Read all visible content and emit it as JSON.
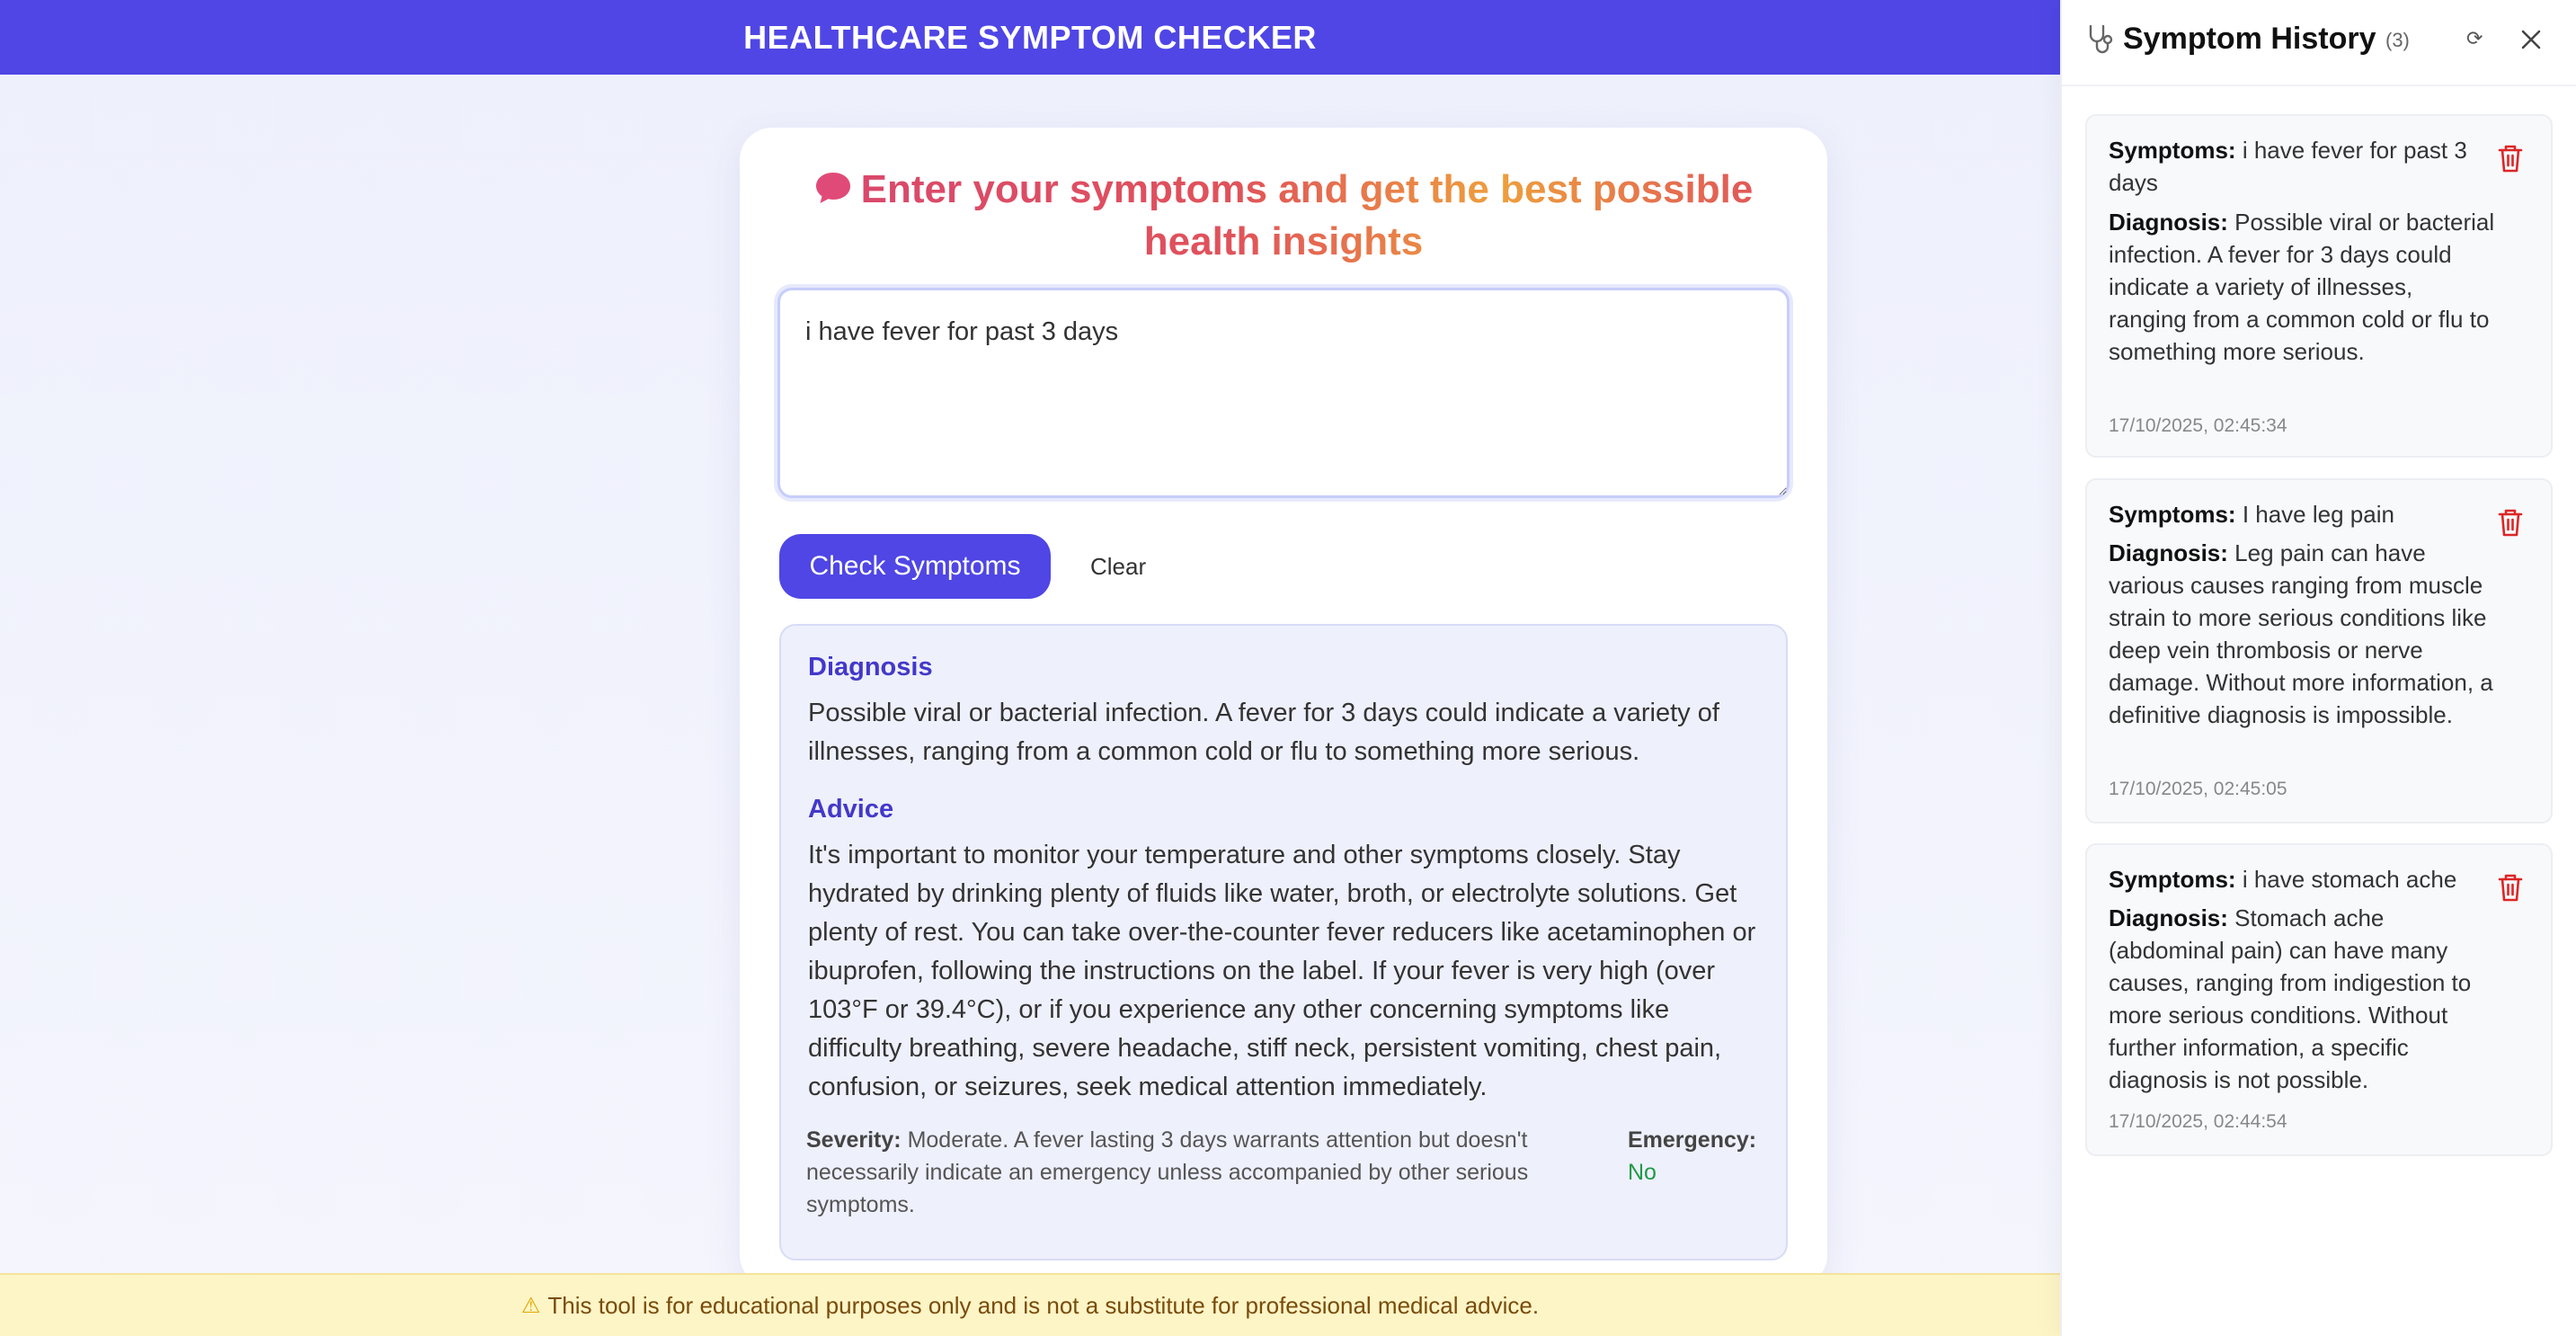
{
  "header": {
    "title": "HEALTHCARE SYMPTOM CHECKER"
  },
  "main": {
    "heading": "Enter your symptoms and get the best possible health insights",
    "input_value": "i have fever for past 3 days",
    "check_button_label": "Check Symptoms",
    "clear_button_label": "Clear",
    "result": {
      "diagnosis_heading": "Diagnosis",
      "diagnosis_text": "Possible viral or bacterial infection. A fever for 3 days could indicate a variety of illnesses, ranging from a common cold or flu to something more serious.",
      "advice_heading": "Advice",
      "advice_text": "It's important to monitor your temperature and other symptoms closely. Stay hydrated by drinking plenty of fluids like water, broth, or electrolyte solutions. Get plenty of rest. You can take over-the-counter fever reducers like acetaminophen or ibuprofen, following the instructions on the label. If your fever is very high (over 103°F or 39.4°C), or if you experience any other concerning symptoms like difficulty breathing, severe headache, stiff neck, persistent vomiting, chest pain, confusion, or seizures, seek medical attention immediately.",
      "severity_label": "Severity:",
      "severity_text": "Moderate. A fever lasting 3 days warrants attention but doesn't necessarily indicate an emergency unless accompanied by other serious symptoms.",
      "emergency_label": "Emergency:",
      "emergency_value": "No"
    }
  },
  "disclaimer": {
    "icon": "warning-icon",
    "text": "This tool is for educational purposes only and is not a substitute for professional medical advice."
  },
  "sidebar": {
    "title": "Symptom History",
    "count": "(3)",
    "items": [
      {
        "symptoms_label": "Symptoms:",
        "symptoms": "i have fever for past 3 days",
        "diagnosis_label": "Diagnosis:",
        "diagnosis": "Possible viral or bacterial infection. A fever for 3 days could indicate a variety of illnesses, ranging from a common cold or flu to something more serious.",
        "timestamp": "17/10/2025, 02:45:34"
      },
      {
        "symptoms_label": "Symptoms:",
        "symptoms": "I have leg pain",
        "diagnosis_label": "Diagnosis:",
        "diagnosis": "Leg pain can have various causes ranging from muscle strain to more serious conditions like deep vein thrombosis or nerve damage. Without more information, a definitive diagnosis is impossible.",
        "timestamp": "17/10/2025, 02:45:05"
      },
      {
        "symptoms_label": "Symptoms:",
        "symptoms": "i have stomach ache",
        "diagnosis_label": "Diagnosis:",
        "diagnosis": "Stomach ache (abdominal pain) can have many causes, ranging from indigestion to more serious conditions. Without further information, a specific diagnosis is not possible.",
        "timestamp": "17/10/2025, 02:44:54"
      }
    ]
  },
  "colors": {
    "primary": "#4f46e5",
    "heading_gradient_start": "#d9466f",
    "heading_gradient_end": "#ee9f3c",
    "emergency_no": "#1f9a48",
    "trash": "#dc2626",
    "disclaimer_bg": "#fdf5c6"
  }
}
